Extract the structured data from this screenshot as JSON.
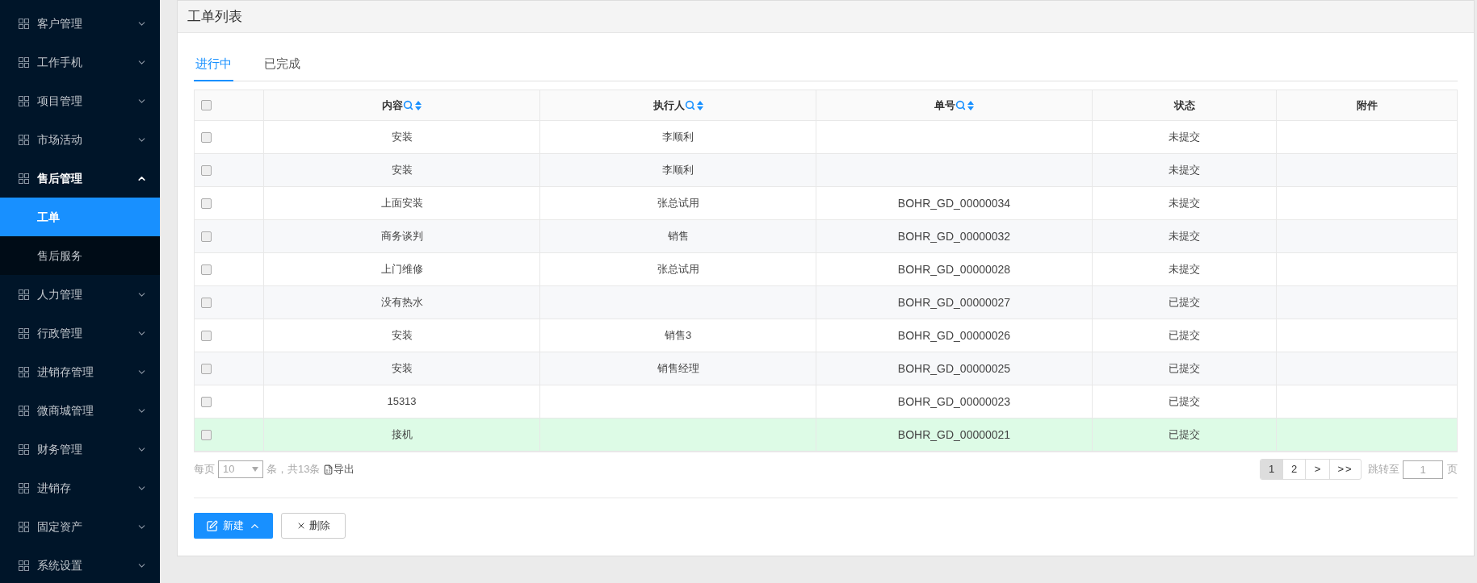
{
  "sidebar": {
    "items": [
      {
        "label": "客户管理",
        "expanded": false
      },
      {
        "label": "工作手机",
        "expanded": false
      },
      {
        "label": "项目管理",
        "expanded": false
      },
      {
        "label": "市场活动",
        "expanded": false
      },
      {
        "label": "售后管理",
        "expanded": true,
        "children": [
          {
            "label": "工单",
            "selected": true
          },
          {
            "label": "售后服务",
            "selected": false
          }
        ]
      },
      {
        "label": "人力管理",
        "expanded": false
      },
      {
        "label": "行政管理",
        "expanded": false
      },
      {
        "label": "进销存管理",
        "expanded": false
      },
      {
        "label": "微商城管理",
        "expanded": false
      },
      {
        "label": "财务管理",
        "expanded": false
      },
      {
        "label": "进销存",
        "expanded": false
      },
      {
        "label": "固定资产",
        "expanded": false
      },
      {
        "label": "系统设置",
        "expanded": false
      }
    ]
  },
  "page_title": "工单列表",
  "tabs": [
    {
      "label": "进行中",
      "selected": true
    },
    {
      "label": "已完成",
      "selected": false
    }
  ],
  "table": {
    "select_all_checked": false,
    "columns": [
      {
        "label": "内容",
        "kind": "filterable"
      },
      {
        "label": "执行人",
        "kind": "filterable"
      },
      {
        "label": "单号",
        "kind": "filterable"
      },
      {
        "label": "状态",
        "kind": "plain"
      },
      {
        "label": "附件",
        "kind": "plain"
      }
    ],
    "rows": [
      {
        "checked": false,
        "selected": false,
        "cells": [
          "安装",
          "李顺利",
          "",
          "未提交",
          ""
        ]
      },
      {
        "checked": false,
        "selected": false,
        "cells": [
          "安装",
          "李顺利",
          "",
          "未提交",
          ""
        ]
      },
      {
        "checked": false,
        "selected": false,
        "cells": [
          "上面安装",
          "张总试用",
          "BOHR_GD_00000034",
          "未提交",
          ""
        ]
      },
      {
        "checked": false,
        "selected": false,
        "cells": [
          "商务谈判",
          "销售",
          "BOHR_GD_00000032",
          "未提交",
          ""
        ]
      },
      {
        "checked": false,
        "selected": false,
        "cells": [
          "上门维修",
          "张总试用",
          "BOHR_GD_00000028",
          "未提交",
          ""
        ]
      },
      {
        "checked": false,
        "selected": false,
        "cells": [
          "没有热水",
          "",
          "BOHR_GD_00000027",
          "已提交",
          ""
        ]
      },
      {
        "checked": false,
        "selected": false,
        "cells": [
          "安装",
          "销售3",
          "BOHR_GD_00000026",
          "已提交",
          ""
        ]
      },
      {
        "checked": false,
        "selected": false,
        "cells": [
          "安装",
          "销售经理",
          "BOHR_GD_00000025",
          "已提交",
          ""
        ]
      },
      {
        "checked": false,
        "selected": false,
        "cells": [
          "15313",
          "",
          "BOHR_GD_00000023",
          "已提交",
          ""
        ]
      },
      {
        "checked": false,
        "selected": true,
        "cells": [
          "接机",
          "",
          "BOHR_GD_00000021",
          "已提交",
          ""
        ]
      }
    ]
  },
  "pagination": {
    "per_page_label": "每页",
    "page_size": "10",
    "total": "条，共13条",
    "export": "导出",
    "pages": [
      {
        "label": "1",
        "selected": true
      },
      {
        "label": "2",
        "selected": false
      }
    ],
    "next": ">",
    "last": ">>",
    "jump_label": "跳转至",
    "jump_value": "1",
    "page_unit": "页"
  },
  "buttons": {
    "create": "新建",
    "delete": "删除"
  }
}
